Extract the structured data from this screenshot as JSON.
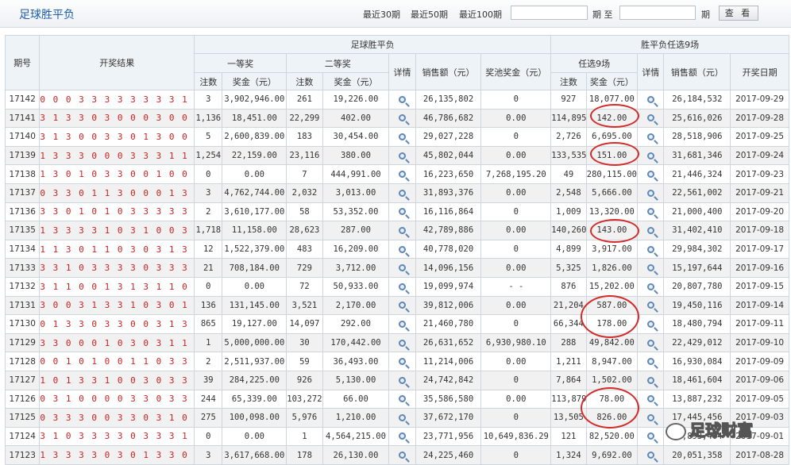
{
  "header": {
    "title": "足球胜平负",
    "recent30": "最近30期",
    "recent50": "最近50期",
    "recent100": "最近100期",
    "period_label": "期 至",
    "period_end": "期",
    "query_button": "查 看",
    "start_value": "",
    "end_value": ""
  },
  "columns": {
    "issue": "期号",
    "result": "开奖结果",
    "group_sfc": "足球胜平负",
    "first_prize": "一等奖",
    "second_prize": "二等奖",
    "count": "注数",
    "amount": "奖金（元）",
    "detail": "详情",
    "sales": "销售额（元）",
    "pool": "奖池奖金（元）",
    "group_r9": "胜平负任选9场",
    "r9": "任选9场",
    "date": "开奖日期"
  },
  "rows": [
    {
      "issue": "17142",
      "result": "0 0 0 3 3 3 3 3 3 3 3 1 1 1",
      "c1": "3",
      "a1": "3,902,946.00",
      "c2": "261",
      "a2": "19,226.00",
      "sales": "26,135,802",
      "pool": "0",
      "rc": "927",
      "ra": "18,077.00",
      "rsales": "26,184,532",
      "date": "2017-09-29"
    },
    {
      "issue": "17141",
      "result": "3 1 3 3 0 3 0 0 0 3 0 0 3 0",
      "c1": "1,136",
      "a1": "18,451.00",
      "c2": "22,299",
      "a2": "402.00",
      "sales": "46,786,682",
      "pool": "0.00",
      "rc": "114,895",
      "ra": "142.00",
      "rsales": "25,616,026",
      "date": "2017-09-28"
    },
    {
      "issue": "17140",
      "result": "3 1 3 0 0 3 3 0 1 3 0 0 0 1",
      "c1": "5",
      "a1": "2,600,839.00",
      "c2": "183",
      "a2": "30,454.00",
      "sales": "29,027,228",
      "pool": "0",
      "rc": "2,726",
      "ra": "6,695.00",
      "rsales": "28,518,906",
      "date": "2017-09-25"
    },
    {
      "issue": "17139",
      "result": "1 3 3 3 0 0 0 3 3 3 1 1 3 3",
      "c1": "1,254",
      "a1": "22,159.00",
      "c2": "23,116",
      "a2": "380.00",
      "sales": "45,802,044",
      "pool": "0.00",
      "rc": "133,535",
      "ra": "151.00",
      "rsales": "31,681,346",
      "date": "2017-09-24"
    },
    {
      "issue": "17138",
      "result": "1 3 0 1 0 3 3 0 0 1 0 0 1 3",
      "c1": "0",
      "a1": "0.00",
      "c2": "7",
      "a2": "444,991.00",
      "sales": "16,223,650",
      "pool": "7,268,195.20",
      "rc": "49",
      "ra": "280,115.00",
      "rsales": "21,446,324",
      "date": "2017-09-23"
    },
    {
      "issue": "17137",
      "result": "0 3 3 0 1 1 3 0 0 0 1 3 3 0",
      "c1": "3",
      "a1": "4,762,744.00",
      "c2": "2,032",
      "a2": "3,013.00",
      "sales": "31,893,376",
      "pool": "0.00",
      "rc": "2,548",
      "ra": "5,666.00",
      "rsales": "22,561,002",
      "date": "2017-09-21"
    },
    {
      "issue": "17136",
      "result": "3 3 0 1 0 1 0 3 3 3 3 3 0 0",
      "c1": "2",
      "a1": "3,610,177.00",
      "c2": "58",
      "a2": "53,352.00",
      "sales": "16,116,864",
      "pool": "0",
      "rc": "1,009",
      "ra": "13,320.00",
      "rsales": "21,000,400",
      "date": "2017-09-20"
    },
    {
      "issue": "17135",
      "result": "1 3 3 3 3 1 0 3 1 0 0 3 0 3",
      "c1": "1,718",
      "a1": "11,158.00",
      "c2": "28,623",
      "a2": "287.00",
      "sales": "42,789,886",
      "pool": "0.00",
      "rc": "140,260",
      "ra": "143.00",
      "rsales": "31,402,410",
      "date": "2017-09-18"
    },
    {
      "issue": "17134",
      "result": "1 1 3 0 1 1 0 3 0 3 1 3 0 3",
      "c1": "12",
      "a1": "1,522,379.00",
      "c2": "483",
      "a2": "16,209.00",
      "sales": "40,778,020",
      "pool": "0",
      "rc": "4,899",
      "ra": "3,917.00",
      "rsales": "29,984,302",
      "date": "2017-09-17"
    },
    {
      "issue": "17133",
      "result": "3 3 1 0 3 3 3 3 0 3 3 3 3 3",
      "c1": "21",
      "a1": "708,184.00",
      "c2": "729",
      "a2": "3,712.00",
      "sales": "14,096,156",
      "pool": "0.00",
      "rc": "5,325",
      "ra": "1,826.00",
      "rsales": "15,197,644",
      "date": "2017-09-16"
    },
    {
      "issue": "17132",
      "result": "3 1 1 0 0 1 3 1 3 1 1 0 3 1",
      "c1": "0",
      "a1": "0.00",
      "c2": "72",
      "a2": "50,933.00",
      "sales": "19,099,974",
      "pool": "- -",
      "rc": "876",
      "ra": "15,202.00",
      "rsales": "20,807,780",
      "date": "2017-09-15"
    },
    {
      "issue": "17131",
      "result": "3 0 0 3 1 3 3 1 0 3 0 1 3 3",
      "c1": "136",
      "a1": "131,145.00",
      "c2": "3,521",
      "a2": "2,170.00",
      "sales": "39,812,006",
      "pool": "0.00",
      "rc": "21,204",
      "ra": "587.00",
      "rsales": "19,450,116",
      "date": "2017-09-14"
    },
    {
      "issue": "17130",
      "result": "0 1 3 3 0 3 3 0 0 3 1 3 3 3",
      "c1": "865",
      "a1": "19,127.00",
      "c2": "14,097",
      "a2": "292.00",
      "sales": "21,460,780",
      "pool": "0",
      "rc": "66,344",
      "ra": "178.00",
      "rsales": "18,480,794",
      "date": "2017-09-11"
    },
    {
      "issue": "17129",
      "result": "3 3 0 0 0 1 0 3 0 3 1 1 3 3",
      "c1": "1",
      "a1": "5,000,000.00",
      "c2": "30",
      "a2": "170,442.00",
      "sales": "26,631,652",
      "pool": "6,930,980.10",
      "rc": "288",
      "ra": "49,842.00",
      "rsales": "22,429,012",
      "date": "2017-09-10"
    },
    {
      "issue": "17128",
      "result": "0 0 1 0 1 0 0 1 1 0 3 3 0 3",
      "c1": "2",
      "a1": "2,511,937.00",
      "c2": "59",
      "a2": "36,493.00",
      "sales": "11,214,006",
      "pool": "0.00",
      "rc": "1,211",
      "ra": "8,947.00",
      "rsales": "16,930,084",
      "date": "2017-09-09"
    },
    {
      "issue": "17127",
      "result": "1 0 1 3 3 1 0 0 3 0 3 3 0 3",
      "c1": "39",
      "a1": "284,225.00",
      "c2": "926",
      "a2": "5,130.00",
      "sales": "24,742,842",
      "pool": "0",
      "rc": "7,864",
      "ra": "1,502.00",
      "rsales": "18,461,604",
      "date": "2017-09-06"
    },
    {
      "issue": "17126",
      "result": "0 3 1 0 0 0 0 3 3 0 3 3 3 3",
      "c1": "244",
      "a1": "65,339.00",
      "c2": "103,272",
      "a2": "66.00",
      "sales": "35,586,580",
      "pool": "0.00",
      "rc": "113,879",
      "ra": "78.00",
      "rsales": "13,887,232",
      "date": "2017-09-05"
    },
    {
      "issue": "17125",
      "result": "0 3 3 3 0 0 3 3 0 3 1 0 3 3",
      "c1": "275",
      "a1": "100,098.00",
      "c2": "5,976",
      "a2": "1,210.00",
      "sales": "37,672,170",
      "pool": "0",
      "rc": "13,505",
      "ra": "826.00",
      "rsales": "17,445,456",
      "date": "2017-09-03"
    },
    {
      "issue": "17124",
      "result": "3 1 0 3 3 3 3 0 3 3 3 1 0 1",
      "c1": "0",
      "a1": "0.00",
      "c2": "1",
      "a2": "4,564,215.00",
      "sales": "23,771,956",
      "pool": "10,649,836.29",
      "rc": "121",
      "ra": "82,520.00",
      "rsales": "20,893,464",
      "date": "2017-09-01"
    },
    {
      "issue": "17123",
      "result": "1 3 3 3 3 0 3 0 1 3 3 0 0 1",
      "c1": "3",
      "a1": "3,617,668.00",
      "c2": "178",
      "a2": "26,130.00",
      "sales": "24,225,460",
      "pool": "0",
      "rc": "1,324",
      "ra": "9,692.00",
      "rsales": "20,051,358",
      "date": "2017-08-28"
    }
  ],
  "watermark": "足球财富",
  "colors": {
    "highlight": "#d42a2a",
    "result_text": "#cc2222",
    "title": "#1f5fa8"
  }
}
